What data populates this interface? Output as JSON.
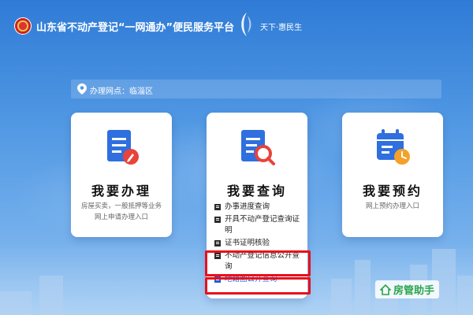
{
  "header": {
    "title": "山东省不动产登记“一网通办”便民服务平台",
    "slogan": "天下·惠民生"
  },
  "location": {
    "label": "办理网点：临淄区"
  },
  "cards": [
    {
      "title": "我要办理",
      "description": "房屋买卖，一般抵押等业务网上申请办理入口",
      "icon": "document-edit-icon"
    },
    {
      "title": "我要查询",
      "icon": "document-search-icon",
      "links": [
        {
          "label": "办事进度查询",
          "active": false
        },
        {
          "label": "开具不动产登记查询证明",
          "active": false
        },
        {
          "label": "证书证明核验",
          "active": false
        },
        {
          "label": "不动产登记信息公开查询",
          "active": false
        },
        {
          "label": "地籍图公开查询",
          "active": true
        }
      ]
    },
    {
      "title": "我要预约",
      "description": "网上预约办理入口",
      "icon": "calendar-clock-icon"
    }
  ],
  "watermark": {
    "text": "房管助手"
  },
  "colors": {
    "accent_blue": "#1c5fd6",
    "highlight_red": "#e8101c",
    "watermark_green": "#2aa44a"
  }
}
